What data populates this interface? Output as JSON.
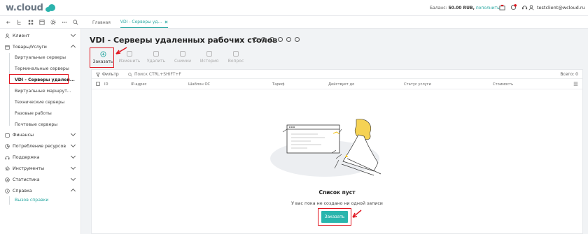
{
  "header": {
    "logo_text": "w.cloud",
    "balance_label": "Баланс:",
    "balance_amount": "50.00 RUB,",
    "balance_link": "пополнить",
    "user_email": "testclient@wcloud.ru"
  },
  "tabs": [
    {
      "label": "Главная"
    },
    {
      "label": "VDI - Серверы уд..."
    }
  ],
  "sidebar": {
    "items": [
      {
        "label": "Клиент"
      },
      {
        "label": "Товары/Услуги"
      },
      {
        "label": "Финансы"
      },
      {
        "label": "Потребление ресурсов"
      },
      {
        "label": "Поддержка"
      },
      {
        "label": "Инструменты"
      },
      {
        "label": "Статистика"
      },
      {
        "label": "Справка"
      }
    ],
    "services": [
      {
        "label": "Виртуальные серверы"
      },
      {
        "label": "Терминальные серверы"
      },
      {
        "label": "VDI - Серверы удален..."
      },
      {
        "label": "Виртуальные маршрут..."
      },
      {
        "label": "Технические серверы"
      },
      {
        "label": "Разовые работы"
      },
      {
        "label": "Почтовые серверы"
      }
    ],
    "help_call": "Вызов справки"
  },
  "page": {
    "title": "VDI - Серверы удаленных рабочих столов",
    "toolbar": [
      {
        "label": "Заказать"
      },
      {
        "label": "Изменить"
      },
      {
        "label": "Удалить"
      },
      {
        "label": "Снимки"
      },
      {
        "label": "История"
      },
      {
        "label": "Вопрос"
      }
    ],
    "filter_label": "Фильтр",
    "search_placeholder": "Поиск CTRL+SHIFT+F",
    "total": "Всего: 0",
    "columns": [
      "ID",
      "IP-адрес",
      "Шаблон ОС",
      "Тариф",
      "Действует до",
      "Статус услуги",
      "Стоимость"
    ],
    "empty_title": "Список пуст",
    "empty_text": "У вас пока не создано ни одной записи",
    "order_button": "Заказать"
  },
  "colors": {
    "accent": "#2ab5ad",
    "highlight": "#e0141e"
  }
}
